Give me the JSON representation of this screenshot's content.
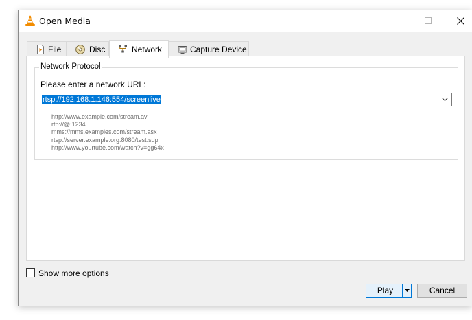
{
  "window": {
    "title": "Open Media",
    "icon": "vlc-cone-icon",
    "controls": [
      "minimize-icon",
      "maximize-icon",
      "close-icon"
    ]
  },
  "tabs": [
    {
      "label": "File",
      "icon": "file-icon",
      "active": false
    },
    {
      "label": "Disc",
      "icon": "disc-icon",
      "active": false
    },
    {
      "label": "Network",
      "icon": "network-icon",
      "active": true
    },
    {
      "label": "Capture Device",
      "icon": "capture-device-icon",
      "active": false
    }
  ],
  "network": {
    "group_label": "Network Protocol",
    "url_label": "Please enter a network URL:",
    "url_value": "rtsp://192.168.1.146:554/screenlive",
    "examples": [
      "http://www.example.com/stream.avi",
      "rtp://@:1234",
      "mms://mms.examples.com/stream.asx",
      "rtsp://server.example.org:8080/test.sdp",
      "http://www.yourtube.com/watch?v=gg64x"
    ]
  },
  "options": {
    "show_more_label": "Show more options",
    "show_more_checked": false
  },
  "buttons": {
    "play_label": "Play",
    "cancel_label": "Cancel"
  },
  "colors": {
    "selection": "#0078d7",
    "vlc_orange": "#f28c00"
  }
}
